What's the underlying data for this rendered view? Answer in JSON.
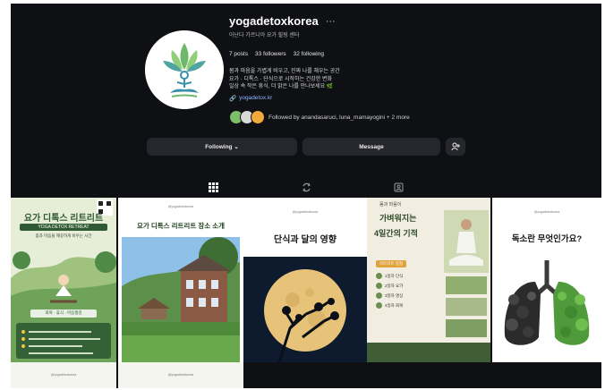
{
  "profile": {
    "username": "yogadetoxkorea",
    "more_label": "···",
    "subtitle": "아난다 가르니아 요가 힐링 센터",
    "stats": {
      "posts": "7 posts",
      "followers": "33 followers",
      "following": "32 following"
    },
    "bio_lines": [
      "몸과 마음을 가볍게 비우고, 진짜 나를 채우는 공간",
      "요가 · 디톡스 · 단식으로 시작하는 건강한 변화",
      "일상 속 작은 휴식, 더 맑은 나를 만나보세요 🌿"
    ],
    "link": "yogadetox.kr",
    "followed_by": "Followed by anandasaruci, luna_mamayogini + 2 more"
  },
  "buttons": {
    "following": "Following ⌄",
    "message": "Message"
  },
  "tabs": [
    "posts",
    "reels",
    "tagged"
  ],
  "posts": [
    {
      "title": "요가 디톡스 리트리트",
      "banner": "YOGA DETOX RETREAT",
      "subtext": "몸과 마음을 깨끗하게 비우는 시간",
      "footer": "회복 · 휴식 · 마음챙김"
    },
    {
      "account": "@yogadetoxkorea",
      "title": "요가 디톡스 리트리트 장소 소개"
    },
    {
      "account": "@yogadetoxkorea",
      "title": "단식과 달의 영향"
    },
    {
      "account": "몸과 마음이",
      "title_line1": "가벼워지는",
      "title_line2": "4일간의 기적",
      "badge": "리트리트 일정",
      "items": [
        "1일차 단식",
        "2일차 요가",
        "3일차 명상",
        "4일차 회복"
      ]
    },
    {
      "account": "@yogadetoxkorea",
      "title": "독소란 무엇인가요?"
    }
  ],
  "bottom_row": [
    {
      "account": "@yogadetoxkorea"
    },
    {
      "account": "@yogadetoxkorea"
    }
  ],
  "colors": {
    "background": "#0f1014",
    "button": "#26272c",
    "link": "#8ab4ff"
  }
}
